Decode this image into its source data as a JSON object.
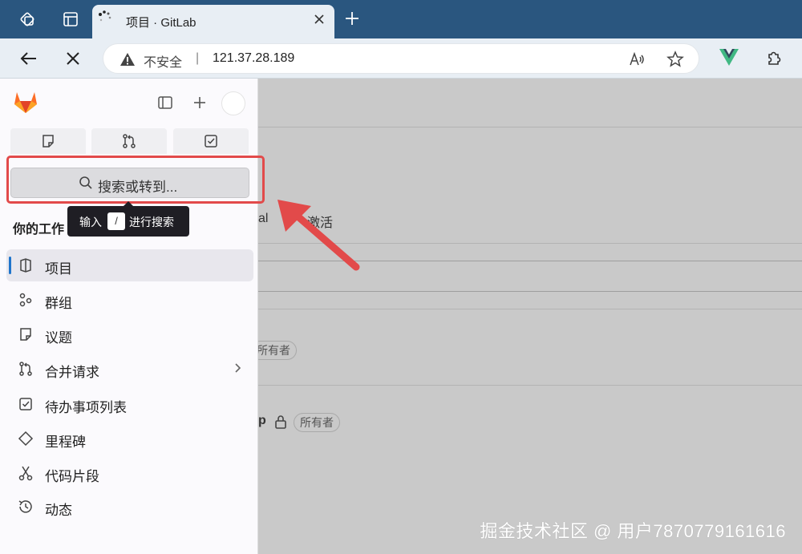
{
  "browser": {
    "tab_title": "项目 · GitLab",
    "url_security": "不安全",
    "url_separator": "|",
    "url": "121.37.28.189"
  },
  "sidebar": {
    "search_label": "搜索或转到...",
    "tooltip_prefix": "输入",
    "tooltip_key": "/",
    "tooltip_suffix": "进行搜索",
    "section_title": "你的工作",
    "items": [
      {
        "label": "项目",
        "icon": "project-icon",
        "active": true
      },
      {
        "label": "群组",
        "icon": "group-icon"
      },
      {
        "label": "议题",
        "icon": "issues-icon"
      },
      {
        "label": "合并请求",
        "icon": "merge-request-icon",
        "chevron": true
      },
      {
        "label": "待办事项列表",
        "icon": "todo-icon"
      },
      {
        "label": "里程碑",
        "icon": "milestone-icon"
      },
      {
        "label": "代码片段",
        "icon": "snippet-icon"
      },
      {
        "label": "动态",
        "icon": "activity-icon"
      }
    ]
  },
  "main": {
    "tab_fragment_a": "al",
    "tab_fragment_b": "激活",
    "row_fragment": "p",
    "owner_badge": "所有者"
  },
  "watermark": "掘金技术社区 @ 用户7870779161616",
  "colors": {
    "tabbar": "#2a567f",
    "highlight": "#e24a4a",
    "active_indicator": "#1f75cb"
  }
}
